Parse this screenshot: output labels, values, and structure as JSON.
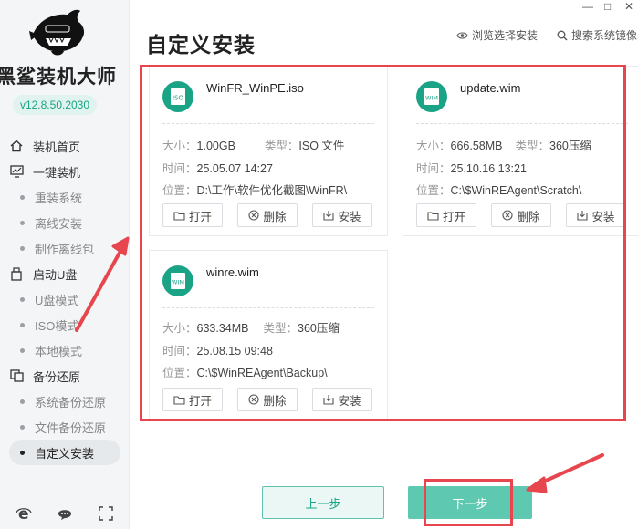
{
  "app": {
    "name": "黑鲨装机大师",
    "version": "v12.8.50.2030"
  },
  "window_controls": {
    "minimize": "—",
    "maximize": "□",
    "close": "✕"
  },
  "header": {
    "title": "自定义安装",
    "browse_label": "浏览选择安装",
    "search_label": "搜索系统镜像"
  },
  "nav": {
    "home": "装机首页",
    "one_click": "一键装机",
    "reinstall": "重装系统",
    "offline_install": "离线安装",
    "make_offline_pkg": "制作离线包",
    "boot_usb": "启动U盘",
    "usb_mode": "U盘模式",
    "iso_mode": "ISO模式",
    "local_mode": "本地模式",
    "backup_restore": "备份还原",
    "sys_backup": "系统备份还原",
    "file_backup": "文件备份还原",
    "custom_install": "自定义安装"
  },
  "labels": {
    "size": "大小：",
    "type": "类型：",
    "time": "时间：",
    "location": "位置：",
    "open": "打开",
    "delete": "删除",
    "install": "安装"
  },
  "files": [
    {
      "icon_text": "ISO",
      "name": "WinFR_WinPE.iso",
      "size": "1.00GB",
      "type": "ISO 文件",
      "time": "25.05.07 14:27",
      "location": "D:\\工作\\软件优化截图\\WinFR\\"
    },
    {
      "icon_text": "WIM",
      "name": "update.wim",
      "size": "666.58MB",
      "type": "360压缩",
      "time": "25.10.16 13:21",
      "location": "C:\\$WinREAgent\\Scratch\\"
    },
    {
      "icon_text": "WIM",
      "name": "winre.wim",
      "size": "633.34MB",
      "type": "360压缩",
      "time": "25.08.15 09:48",
      "location": "C:\\$WinREAgent\\Backup\\"
    }
  ],
  "footer": {
    "prev": "上一步",
    "next": "下一步"
  },
  "colors": {
    "accent": "#1aa385",
    "annotation_red": "#e8464e",
    "next_button": "#5ec8b0"
  }
}
